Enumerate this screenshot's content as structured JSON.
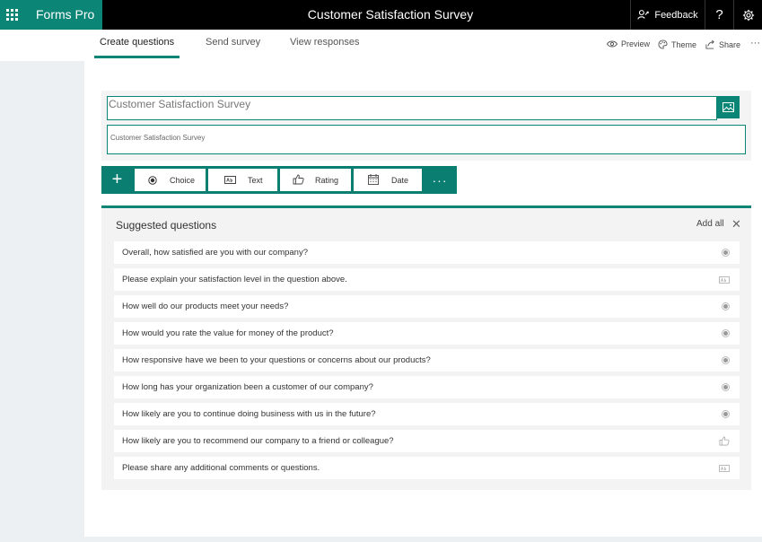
{
  "app": {
    "name": "Forms Pro"
  },
  "header": {
    "doc_title": "Customer Satisfaction Survey",
    "feedback_label": "Feedback",
    "help_label": "?"
  },
  "tabs": [
    {
      "label": "Create questions",
      "active": true
    },
    {
      "label": "Send survey",
      "active": false
    },
    {
      "label": "View responses",
      "active": false
    }
  ],
  "actions": {
    "preview": "Preview",
    "theme": "Theme",
    "share": "Share",
    "more": "···"
  },
  "form": {
    "title_value": "Customer Satisfaction Survey",
    "description_value": "Customer Satisfaction Survey"
  },
  "question_types": [
    {
      "label": "Choice",
      "icon": "radio-icon"
    },
    {
      "label": "Text",
      "icon": "text-box-icon"
    },
    {
      "label": "Rating",
      "icon": "thumbs-up-icon"
    },
    {
      "label": "Date",
      "icon": "calendar-icon"
    }
  ],
  "add_symbol": "+",
  "more_types_symbol": "···",
  "suggested": {
    "title": "Suggested questions",
    "add_all_label": "Add all",
    "close_symbol": "✕",
    "items": [
      {
        "text": "Overall, how satisfied are you with our company?",
        "icon": "radio-icon"
      },
      {
        "text": "Please explain your satisfaction level in the question above.",
        "icon": "text-box-icon"
      },
      {
        "text": "How well do our products meet your needs?",
        "icon": "radio-icon"
      },
      {
        "text": "How would you rate the value for money of the product?",
        "icon": "radio-icon"
      },
      {
        "text": "How responsive have we been to your questions or concerns about our products?",
        "icon": "radio-icon"
      },
      {
        "text": "How long has your organization been a customer of our company?",
        "icon": "radio-icon"
      },
      {
        "text": "How likely are you to continue doing business with us in the future?",
        "icon": "radio-icon"
      },
      {
        "text": "How likely are you to recommend our company to a friend or colleague?",
        "icon": "thumbs-up-icon"
      },
      {
        "text": "Please share any additional comments or questions.",
        "icon": "text-box-icon"
      }
    ]
  },
  "colors": {
    "accent": "#0b8576",
    "topbar": "#000000",
    "background": "#ecf0f3"
  }
}
